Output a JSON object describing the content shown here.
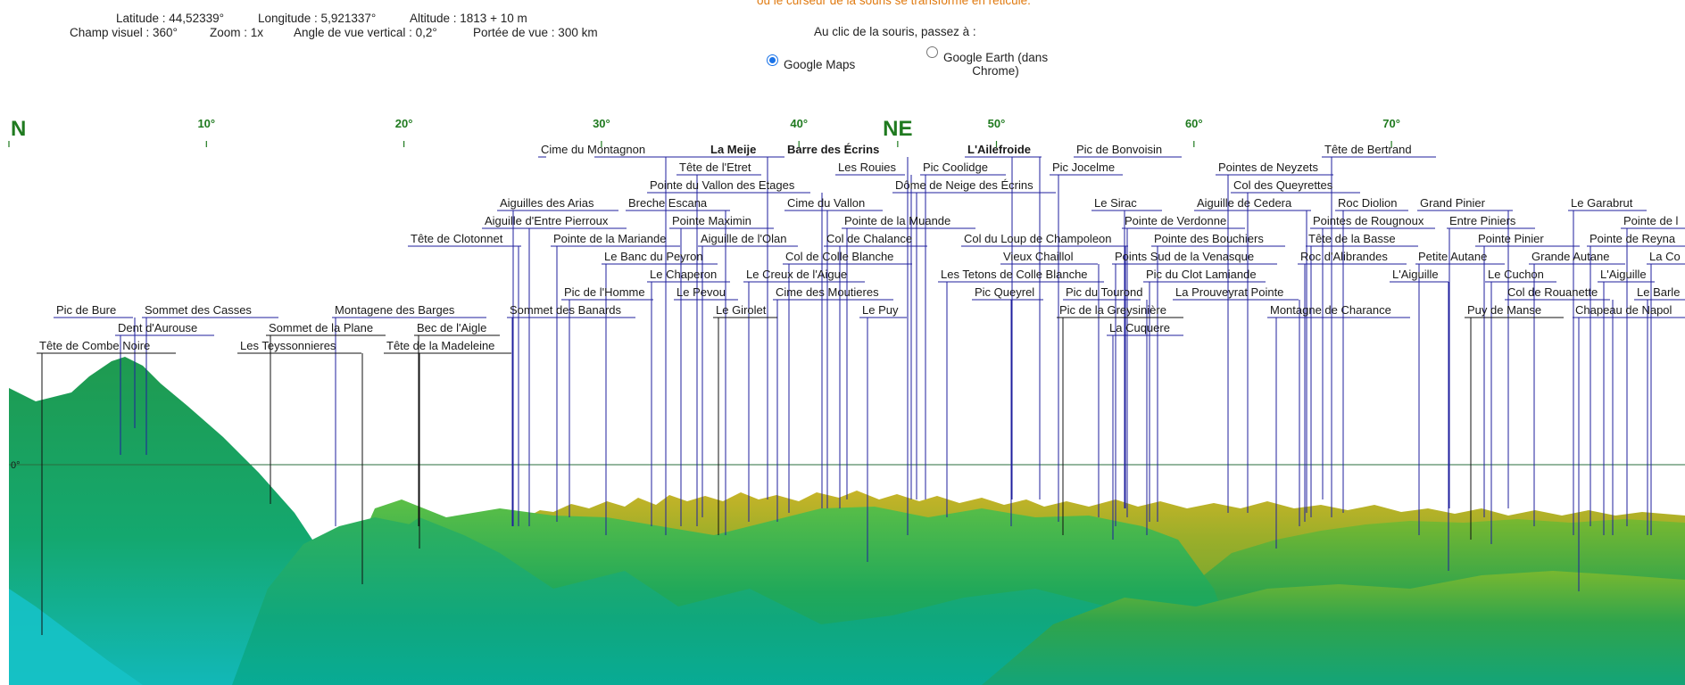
{
  "header": {
    "latitude": "Latitude : 44,52339°",
    "longitude": "Longitude : 5,921337°",
    "altitude": "Altitude : 1813 + 10 m",
    "field": "Champ visuel : 360°",
    "zoom": "Zoom : 1x",
    "angle": "Angle de vue vertical : 0,2°",
    "range": "Portée de vue : 300 km",
    "cursor_note": "ou le curseur de la souris se transforme en réticule.",
    "click_prompt": "Au clic de la souris, passez à :",
    "option_maps": "Google Maps",
    "option_earth_1": "Google Earth (dans",
    "option_earth_2": "Chrome)"
  },
  "colors": {
    "label_line": "#1f1f9e",
    "label_line_black": "#111111",
    "compass": "#1f7a1f",
    "note": "#e07b12"
  },
  "compass": [
    {
      "label": "N",
      "deg": 0
    },
    {
      "label": "10°",
      "deg": 10
    },
    {
      "label": "20°",
      "deg": 20
    },
    {
      "label": "30°",
      "deg": 30
    },
    {
      "label": "40°",
      "deg": 40
    },
    {
      "label": "NE",
      "deg": 45
    },
    {
      "label": "50°",
      "deg": 50
    },
    {
      "label": "60°",
      "deg": 60
    },
    {
      "label": "70°",
      "deg": 70
    }
  ],
  "horizon_label": "0°",
  "peaks": [
    {
      "name": "Cime du Montagnon"
    },
    {
      "name": "La Meije",
      "bold": true
    },
    {
      "name": "Barre des Écrins",
      "bold": true
    },
    {
      "name": "L'Ailefroide",
      "bold": true
    },
    {
      "name": "Pic de Bonvoisin"
    },
    {
      "name": "Tête de Bertrand"
    },
    {
      "name": "Tête de l'Etret"
    },
    {
      "name": "Les Rouies"
    },
    {
      "name": "Pic Coolidge"
    },
    {
      "name": "Pic Jocelme"
    },
    {
      "name": "Pointes de Neyzets"
    },
    {
      "name": "Pointe du Vallon des Etages"
    },
    {
      "name": "Dôme de Neige des Écrins"
    },
    {
      "name": "Col des Queyrettes"
    },
    {
      "name": "Aiguilles des Arias"
    },
    {
      "name": "Breche Escana"
    },
    {
      "name": "Cime du Vallon"
    },
    {
      "name": "Le Sirac"
    },
    {
      "name": "Aiguille de Cedera"
    },
    {
      "name": "Roc Diolion"
    },
    {
      "name": "Grand Pinier"
    },
    {
      "name": "Le Garabrut"
    },
    {
      "name": "Aiguille d'Entre Pierroux"
    },
    {
      "name": "Pointe Maximin"
    },
    {
      "name": "Pointe de la Muande"
    },
    {
      "name": "Pointe de Verdonne"
    },
    {
      "name": "Pointes de Rougnoux"
    },
    {
      "name": "Entre Piniers"
    },
    {
      "name": "Pointe de l"
    },
    {
      "name": "Tête de Clotonnet"
    },
    {
      "name": "Pointe de la Mariande"
    },
    {
      "name": "Aiguille de l'Olan"
    },
    {
      "name": "Col de Chalance"
    },
    {
      "name": "Col du Loup de Champoleon"
    },
    {
      "name": "Pointe des Bouchiers"
    },
    {
      "name": "Tête de la Basse"
    },
    {
      "name": "Pointe Pinier"
    },
    {
      "name": "Pointe de Reyna"
    },
    {
      "name": "Le Banc du Peyron"
    },
    {
      "name": "Col de Colle Blanche"
    },
    {
      "name": "Vieux Chaillol"
    },
    {
      "name": "Points Sud de la Venasque"
    },
    {
      "name": "Roc d'Alibrandes"
    },
    {
      "name": "Petite Autane"
    },
    {
      "name": "Grande Autane"
    },
    {
      "name": "La Co"
    },
    {
      "name": "Le Chaperon"
    },
    {
      "name": "Le Creux de l'Aigue"
    },
    {
      "name": "Les Tetons de Colle Blanche"
    },
    {
      "name": "Pic du Clot Lamiande"
    },
    {
      "name": "L'Aiguille"
    },
    {
      "name": "Le Cuchon"
    },
    {
      "name": "L'Aiguille"
    },
    {
      "name": "Pic de l'Homme"
    },
    {
      "name": "Le Pevou"
    },
    {
      "name": "Cime des Moutieres"
    },
    {
      "name": "Pic Queyrel"
    },
    {
      "name": "Pic du Tourond"
    },
    {
      "name": "La Prouveyrat Pointe"
    },
    {
      "name": "Col de Rouanette"
    },
    {
      "name": "Le Barle"
    },
    {
      "name": "Pic de Bure"
    },
    {
      "name": "Sommet des Casses"
    },
    {
      "name": "Montagene des Barges"
    },
    {
      "name": "Sommet des Banards"
    },
    {
      "name": "Le Girolet"
    },
    {
      "name": "Le Puy"
    },
    {
      "name": "Pic de la Greysinière"
    },
    {
      "name": "Montagne de Charance"
    },
    {
      "name": "Puy de Manse"
    },
    {
      "name": "Chapeau de Napol"
    },
    {
      "name": "Dent d'Aurouse"
    },
    {
      "name": "Sommet de la Plane"
    },
    {
      "name": "Bec de l'Aigle"
    },
    {
      "name": "La Cuquere"
    },
    {
      "name": "Tête de Combe Noire"
    },
    {
      "name": "Les Teyssonnieres"
    },
    {
      "name": "Tête de la Madeleine"
    }
  ]
}
